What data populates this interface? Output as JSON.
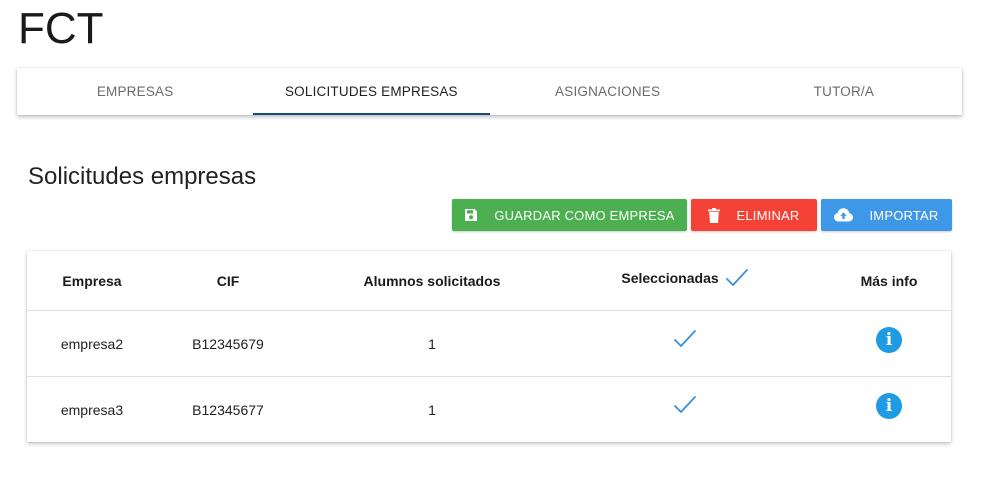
{
  "app": {
    "title": "FCT"
  },
  "tabs": [
    {
      "label": "EMPRESAS",
      "active": false
    },
    {
      "label": "SOLICITUDES EMPRESAS",
      "active": true
    },
    {
      "label": "ASIGNACIONES",
      "active": false
    },
    {
      "label": "TUTOR/A",
      "active": false
    }
  ],
  "section": {
    "title": "Solicitudes empresas"
  },
  "toolbar": {
    "save_label": "GUARDAR COMO EMPRESA",
    "delete_label": "ELIMINAR",
    "import_label": "IMPORTAR"
  },
  "table": {
    "headers": {
      "empresa": "Empresa",
      "cif": "CIF",
      "alumnos": "Alumnos solicitados",
      "seleccionadas": "Seleccionadas",
      "info": "Más info"
    },
    "rows": [
      {
        "empresa": "empresa2",
        "cif": "B12345679",
        "alumnos": "1",
        "seleccionada": true
      },
      {
        "empresa": "empresa3",
        "cif": "B12345677",
        "alumnos": "1",
        "seleccionada": true
      }
    ]
  },
  "colors": {
    "save": "#4caf50",
    "delete": "#f44336",
    "import": "#3f97e8",
    "tab_indicator": "#1a4b7a",
    "check": "#3a8fd9",
    "info_icon": "#1e9be3"
  },
  "icons": {
    "save": "floppy-disk-icon",
    "delete": "trash-icon",
    "import": "cloud-upload-icon",
    "selected": "check-icon",
    "info": "info-icon"
  }
}
